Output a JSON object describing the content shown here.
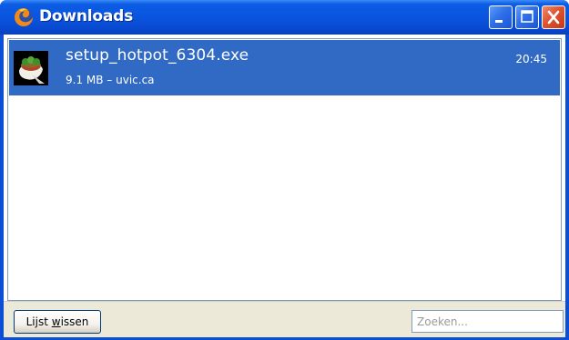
{
  "window": {
    "title": "Downloads",
    "accent_color": "#0a55df",
    "controls": [
      "minimize-icon",
      "maximize-icon",
      "close-icon"
    ]
  },
  "downloads": [
    {
      "icon": "hotpotatoes-app-icon",
      "filename": "setup_hotpot_6304.exe",
      "status": "9.1 MB – uvic.ca",
      "time": "20:45",
      "selected": true,
      "highlight_color": "#316ac5"
    }
  ],
  "footer": {
    "clear_button_prefix": "Lijst ",
    "clear_button_mnemonic": "w",
    "clear_button_suffix": "issen",
    "search_placeholder": "Zoeken...",
    "search_value": ""
  }
}
